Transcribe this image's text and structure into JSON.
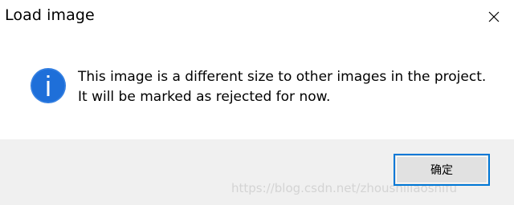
{
  "window": {
    "title": "Load image",
    "close_icon": "close-icon"
  },
  "content": {
    "icon": "info-icon",
    "message_line1": "This image is a different size to other images in the project.",
    "message_line2": "It will be marked as rejected for now."
  },
  "buttons": {
    "ok_label": "确定"
  },
  "watermark": {
    "text": "https://blog.csdn.net/zhoushiliaoshifu"
  },
  "colors": {
    "info_icon": "#1e6fd9",
    "button_border": "#0078d7",
    "button_area": "#f0f0f0"
  }
}
